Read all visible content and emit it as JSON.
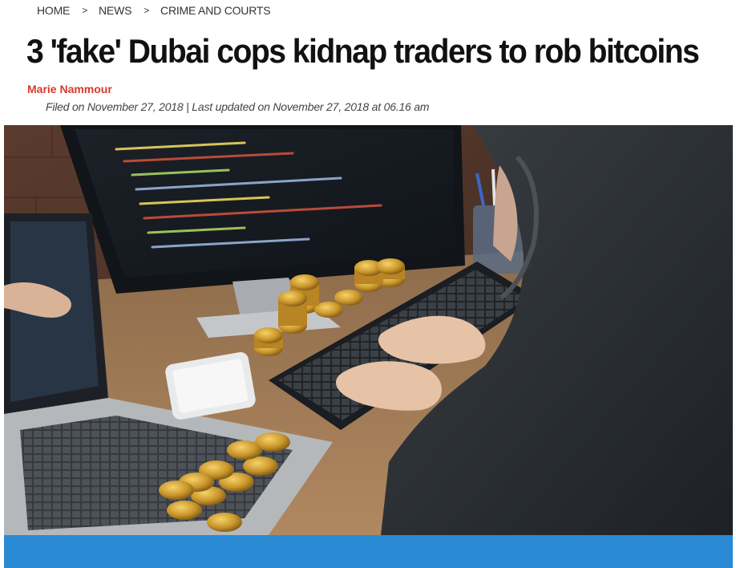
{
  "breadcrumb": {
    "items": [
      {
        "label": "HOME"
      },
      {
        "label": "NEWS"
      },
      {
        "label": "CRIME AND COURTS"
      }
    ],
    "separator": ">"
  },
  "article": {
    "headline": "3 'fake' Dubai cops kidnap traders to rob bitcoins",
    "author": "Marie Nammour",
    "meta": "Filed on November 27, 2018 | Last updated on November 27, 2018 at 06.16 am"
  },
  "colors": {
    "author": "#d83a2c",
    "bar": "#2b8ad4"
  }
}
